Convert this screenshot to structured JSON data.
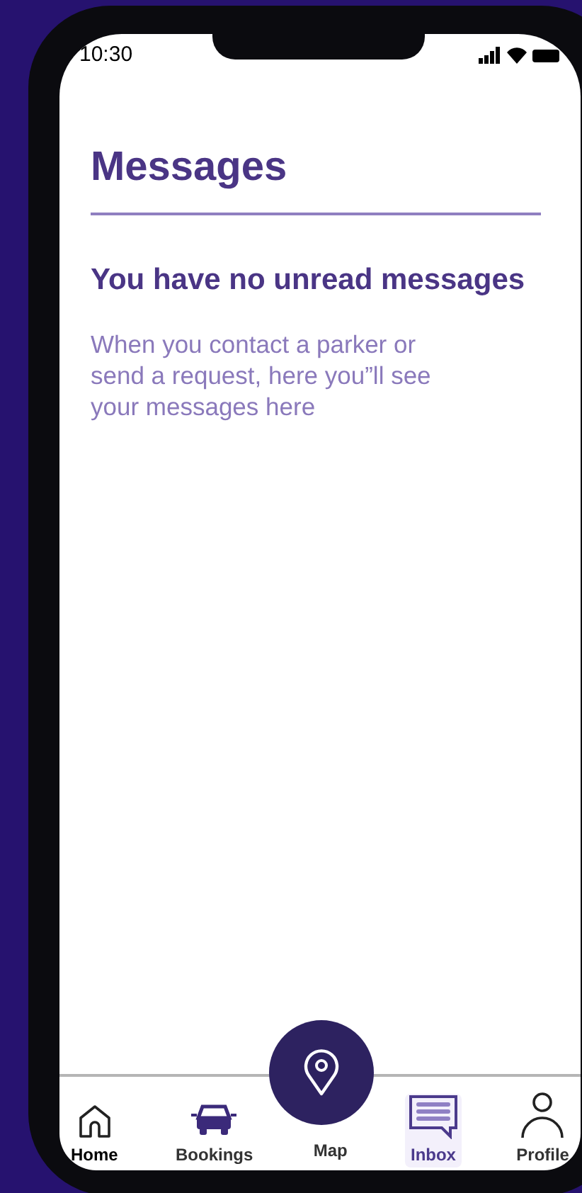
{
  "status_bar": {
    "time": "10:30"
  },
  "header": {
    "title": "Messages"
  },
  "empty_state": {
    "heading": "You have no unread messages",
    "body": "When you contact a parker or send a request, here you”ll see your messages here"
  },
  "tab_bar": [
    {
      "kind": "home",
      "label": "Home",
      "selected": false
    },
    {
      "kind": "car",
      "label": "Bookings",
      "selected": false
    },
    {
      "kind": "map",
      "label": "Map",
      "selected": false
    },
    {
      "kind": "inbox",
      "label": "Inbox",
      "selected": true
    },
    {
      "kind": "profile",
      "label": "Profile",
      "selected": false
    }
  ]
}
